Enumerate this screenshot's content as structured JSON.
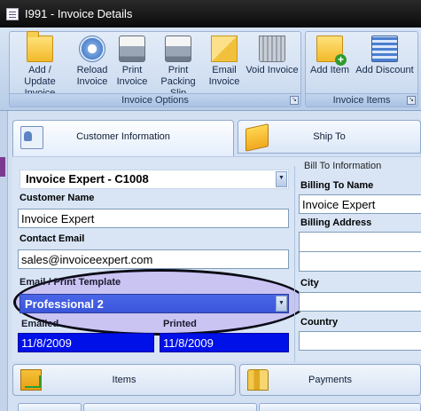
{
  "window": {
    "title": "I991 - Invoice Details"
  },
  "ribbon": {
    "groups": [
      {
        "caption": "Invoice Options",
        "buttons": [
          {
            "line1": "Add / Update",
            "line2": "Invoice",
            "icon": "folder-icon"
          },
          {
            "line1": "Reload",
            "line2": "Invoice",
            "icon": "reload-icon"
          },
          {
            "line1": "Print",
            "line2": "Invoice",
            "icon": "printer-icon"
          },
          {
            "line1": "Print",
            "line2": "Packing Slip",
            "icon": "printer-icon"
          },
          {
            "line1": "Email",
            "line2": "Invoice",
            "icon": "envelope-icon"
          },
          {
            "line1": "Void Invoice",
            "line2": "",
            "icon": "trash-icon"
          }
        ]
      },
      {
        "caption": "Invoice Items",
        "buttons": [
          {
            "line1": "Add Item",
            "line2": "",
            "icon": "add-folder-icon"
          },
          {
            "line1": "Add Discount",
            "line2": "",
            "icon": "calculator-icon"
          }
        ]
      }
    ]
  },
  "tabs": {
    "customer": "Customer Information",
    "ship": "Ship To",
    "items": "Items",
    "payments": "Payments"
  },
  "customer": {
    "selected": "Invoice Expert - C1008",
    "name_label": "Customer Name",
    "name_value": "Invoice Expert",
    "email_label": "Contact Email",
    "email_value": "sales@invoiceexpert.com",
    "template_label": "Email / Print Template",
    "template_value": "Professional 2",
    "emailed_label": "Emailed",
    "emailed_value": "11/8/2009",
    "printed_label": "Printed",
    "printed_value": "11/8/2009"
  },
  "billing": {
    "legend": "Bill To Information",
    "name_label": "Billing To Name",
    "name_value": "Invoice Expert",
    "address_label": "Billing Address",
    "city_label": "City",
    "country_label": "Country"
  },
  "colors": {
    "highlight": "#3a55da",
    "date_fill": "#0010e8"
  }
}
